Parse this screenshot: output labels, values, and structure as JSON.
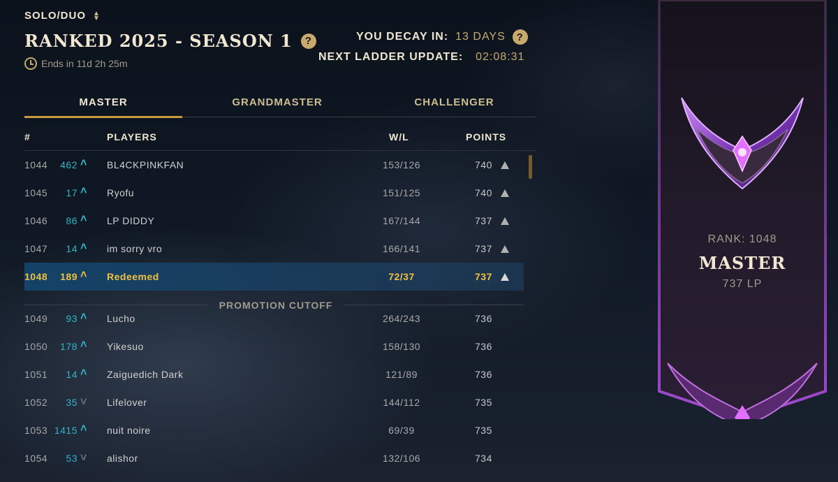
{
  "header": {
    "queue_label": "SOLO/DUO",
    "season_title": "RANKED 2025 - SEASON 1",
    "ends_text": "Ends in 11d 2h 25m",
    "decay_label": "YOU DECAY IN:",
    "decay_value": "13 DAYS",
    "ladder_label": "NEXT LADDER UPDATE:",
    "ladder_value": "02:08:31",
    "help_glyph": "?"
  },
  "tabs": [
    {
      "label": "MASTER",
      "active": true
    },
    {
      "label": "GRANDMASTER",
      "active": false
    },
    {
      "label": "CHALLENGER",
      "active": false
    }
  ],
  "columns": {
    "rank": "#",
    "players": "PLAYERS",
    "wl": "W/L",
    "points": "POINTS"
  },
  "rows": [
    {
      "rank": "1044",
      "delta": "462",
      "trend": "up",
      "name": "BL4CKPINKFAN",
      "wl": "153/126",
      "points": "740",
      "promo": true
    },
    {
      "rank": "1045",
      "delta": "17",
      "trend": "up",
      "name": "Ryofu",
      "wl": "151/125",
      "points": "740",
      "promo": true
    },
    {
      "rank": "1046",
      "delta": "86",
      "trend": "up",
      "name": "LP DIDDY",
      "wl": "167/144",
      "points": "737",
      "promo": true
    },
    {
      "rank": "1047",
      "delta": "14",
      "trend": "up",
      "name": "im sorry vro",
      "wl": "166/141",
      "points": "737",
      "promo": true
    },
    {
      "rank": "1048",
      "delta": "189",
      "trend": "up",
      "name": "Redeemed",
      "wl": "72/37",
      "points": "737",
      "promo": true,
      "is_self": true
    },
    {
      "rank": "1049",
      "delta": "93",
      "trend": "up",
      "name": "Lucho",
      "wl": "264/243",
      "points": "736",
      "promo": false
    },
    {
      "rank": "1050",
      "delta": "178",
      "trend": "up",
      "name": "Yikesuo",
      "wl": "158/130",
      "points": "736",
      "promo": false
    },
    {
      "rank": "1051",
      "delta": "14",
      "trend": "up",
      "name": "Zaiguedich Dark",
      "wl": "121/89",
      "points": "736",
      "promo": false
    },
    {
      "rank": "1052",
      "delta": "35",
      "trend": "down",
      "name": "Lifelover",
      "wl": "144/112",
      "points": "735",
      "promo": false
    },
    {
      "rank": "1053",
      "delta": "1415",
      "trend": "up",
      "name": "nuit noire",
      "wl": "69/39",
      "points": "735",
      "promo": false
    },
    {
      "rank": "1054",
      "delta": "53",
      "trend": "down",
      "name": "alishor",
      "wl": "132/106",
      "points": "734",
      "promo": false
    }
  ],
  "cutoff_label": "PROMOTION CUTOFF",
  "banner": {
    "rank_text": "RANK: 1048",
    "tier": "MASTER",
    "lp_text": "737 LP"
  },
  "colors": {
    "gold": "#c8aa6e",
    "tab_underline": "#c89b3c",
    "trend_up": "#30b4c8",
    "trend_down": "#6e7180",
    "self_highlight": "#f0c040",
    "master_purple": "#8a3fd0"
  },
  "icons": {
    "queue_toggle": "chevron-up-down-icon",
    "help": "question-icon",
    "clock": "clock-icon",
    "trend_up": "chevron-up-icon",
    "trend_down": "chevron-down-icon",
    "promo": "triangle-up-icon",
    "emblem": "master-emblem-icon"
  }
}
